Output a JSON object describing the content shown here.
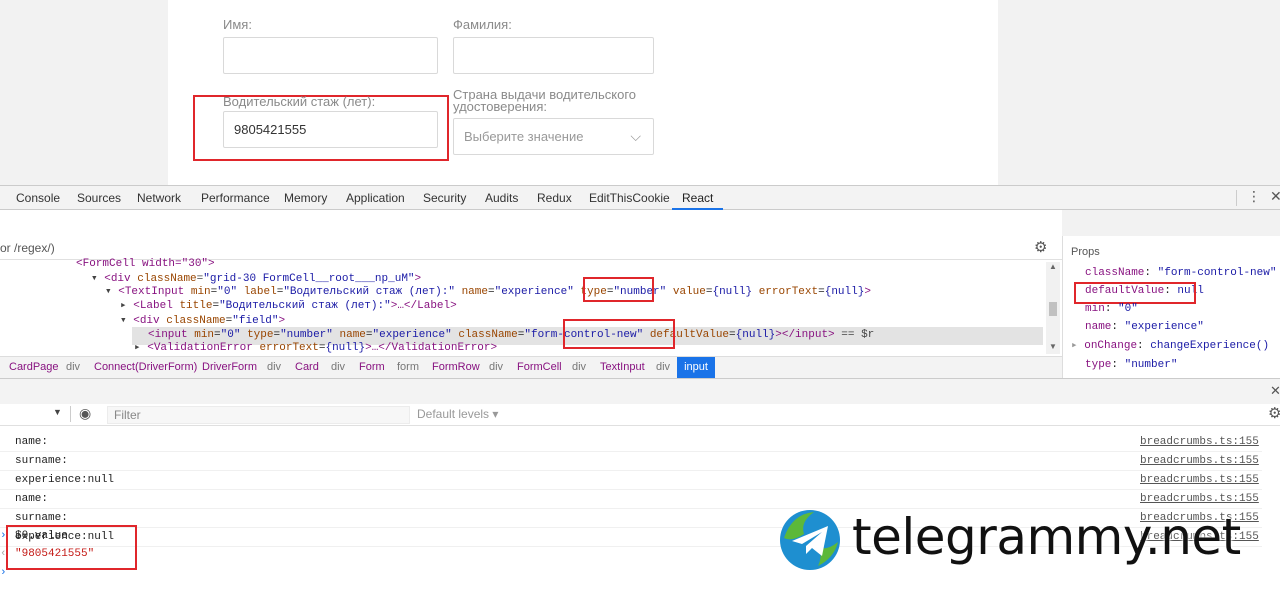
{
  "form": {
    "first_name_label": "Имя:",
    "last_name_label": "Фамилия:",
    "experience_label": "Водительский стаж (лет):",
    "experience_value": "9805421555",
    "country_label": "Страна выдачи водительского удостоверения:",
    "country_placeholder": "Выберите значение"
  },
  "devtools": {
    "tabs": [
      "Console",
      "Sources",
      "Network",
      "Performance",
      "Memory",
      "Application",
      "Security",
      "Audits",
      "Redux",
      "EditThisCookie",
      "React"
    ],
    "active_tab": "React",
    "search_hint": "or /regex/)",
    "tree": {
      "line0": "<FormCell width=\"30\">",
      "line1": {
        "tag": "<div ",
        "attr": "className",
        "eq": "=",
        "val": "\"grid-30 FormCell__root___np_uM\"",
        "close": ">"
      },
      "line2": {
        "t1": "<TextInput ",
        "a1": "min",
        "v1": "\"0\"",
        "a2": "label",
        "v2": "\"Водительский стаж (лет):\"",
        "a3": "name",
        "v3": "\"experience\"",
        "a4": "type",
        "v4": "\"number\"",
        "a5": "value",
        "v5": "{null}",
        "a6": "errorText",
        "v6": "{null}",
        "close": ">"
      },
      "line3": {
        "t1": "<Label ",
        "a1": "title",
        "v1": "\"Водительский стаж (лет):\"",
        "rest": ">…</Label>"
      },
      "line4": {
        "t1": "<div ",
        "a1": "className",
        "v1": "\"field\"",
        "close": ">"
      },
      "line5": {
        "t1": "<input ",
        "a1": "min",
        "v1": "\"0\"",
        "a2": "type",
        "v2": "\"number\"",
        "a3": "name",
        "v3": "\"experience\"",
        "a4": "className",
        "v4": "\"form-control-new\"",
        "a5": "defaultValue",
        "v5": "{null}",
        "close": "></input>",
        "tail": "== $r"
      },
      "line6": {
        "t1": "<ValidationError ",
        "a1": "errorText",
        "v1": "{null}",
        "rest": ">…</ValidationError>"
      }
    },
    "breadcrumbs": [
      "CardPage",
      "div",
      "Connect(DriverForm)",
      "DriverForm",
      "div",
      "Card",
      "div",
      "Form",
      "form",
      "FormRow",
      "div",
      "FormCell",
      "div",
      "TextInput",
      "div",
      "input"
    ],
    "props": {
      "title": "Props",
      "items": [
        {
          "key": "className",
          "value": "\"form-control-new\""
        },
        {
          "key": "defaultValue",
          "value": "null"
        },
        {
          "key": "min",
          "value": "\"0\""
        },
        {
          "key": "name",
          "value": "\"experience\""
        },
        {
          "key": "onChange",
          "value": "changeExperience()"
        },
        {
          "key": "type",
          "value": "\"number\""
        }
      ]
    }
  },
  "console": {
    "filter_placeholder": "Filter",
    "levels": "Default levels ▾",
    "rows": [
      {
        "msg": "name:",
        "src": "breadcrumbs.ts:155"
      },
      {
        "msg": "surname:",
        "src": "breadcrumbs.ts:155"
      },
      {
        "msg": "experience:null",
        "src": "breadcrumbs.ts:155"
      },
      {
        "msg": "name:",
        "src": "breadcrumbs.ts:155"
      },
      {
        "msg": "surname:",
        "src": "breadcrumbs.ts:155"
      },
      {
        "msg": "experience:null",
        "src": "breadcrumbs.ts:155"
      }
    ],
    "input_cmd": "$0.value",
    "result": "\"9805421555\""
  },
  "watermark": {
    "text": "telegrammy.net"
  },
  "colors": {
    "highlight_red": "#e0262b",
    "active_blue": "#1a73e8"
  }
}
